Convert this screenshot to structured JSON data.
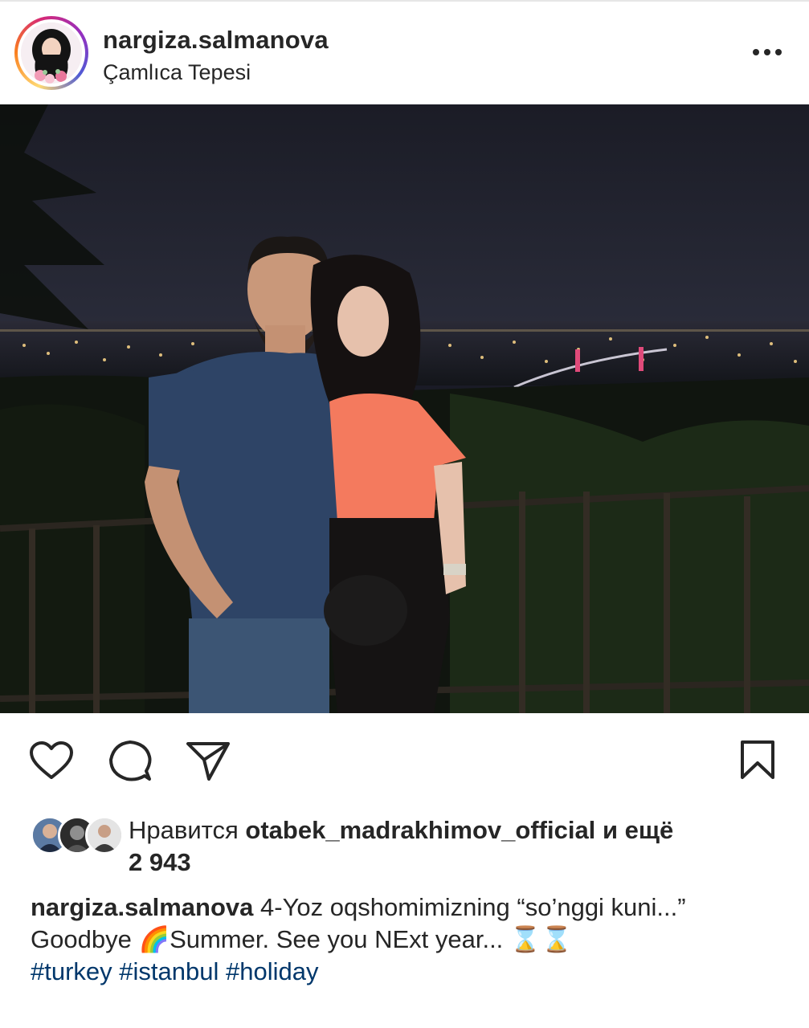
{
  "post": {
    "username": "nargiza.salmanova",
    "location": "Çamlıca Tepesi",
    "more_icon": "more-horizontal-icon"
  },
  "actions": {
    "icons": [
      "heart-icon",
      "comment-icon",
      "share-icon",
      "bookmark-icon"
    ]
  },
  "likes": {
    "prefix": "Нравится",
    "liker": "otabek_madrakhimov_official",
    "conjunction": "и ещё",
    "count": "2 943"
  },
  "caption": {
    "username": "nargiza.salmanova",
    "line1": "4-Yoz oqshomimizning “so’nggi kuni...”",
    "line2_a": "Goodbye",
    "rainbow": "🌈",
    "line2_b": "Summer. See you NExt year...",
    "hourglasses": "⌛️⌛️",
    "hashtags": [
      "#turkey",
      "#istanbul",
      "#holiday"
    ]
  },
  "colors": {
    "text": "#262626",
    "hashtag": "#00376b",
    "divider": "#e6e6e6"
  }
}
